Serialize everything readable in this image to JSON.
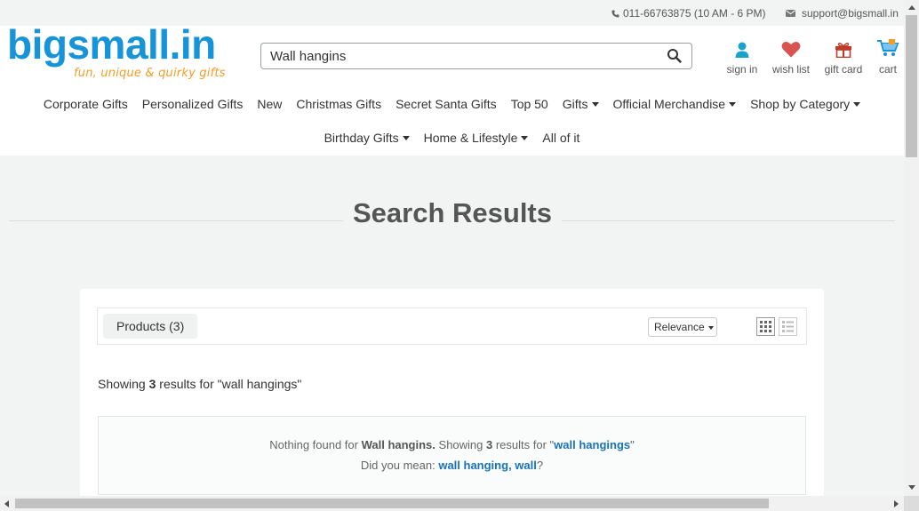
{
  "topbar": {
    "phone": "011-66763875 (10 AM - 6 PM)",
    "email": "support@bigsmall.in",
    "phone_icon": "phone-icon",
    "mail_icon": "envelope-icon"
  },
  "brand": {
    "name": "bigsmall.in",
    "tagline": "fun, unique & quirky gifts",
    "color": "#1793d8",
    "tagline_color": "#f39c26"
  },
  "search": {
    "value": "Wall hangins",
    "icon": "search-icon"
  },
  "header_icons": [
    {
      "label": "sign in",
      "icon": "user-icon",
      "color": "#1aa3c8"
    },
    {
      "label": "wish list",
      "icon": "heart-icon",
      "color": "#d9534f"
    },
    {
      "label": "gift card",
      "icon": "gift-icon",
      "color": "#c0392b"
    },
    {
      "label": "cart",
      "icon": "cart-icon",
      "color": "#1793d8"
    }
  ],
  "nav": {
    "row1": [
      {
        "label": "Corporate Gifts",
        "dropdown": false
      },
      {
        "label": "Personalized Gifts",
        "dropdown": false
      },
      {
        "label": "New",
        "dropdown": false
      },
      {
        "label": "Christmas Gifts",
        "dropdown": false
      },
      {
        "label": "Secret Santa Gifts",
        "dropdown": false
      },
      {
        "label": "Top 50",
        "dropdown": false
      },
      {
        "label": "Gifts",
        "dropdown": true
      },
      {
        "label": "Official Merchandise",
        "dropdown": true
      },
      {
        "label": "Shop by Category",
        "dropdown": true
      }
    ],
    "row2": [
      {
        "label": "Birthday Gifts",
        "dropdown": true
      },
      {
        "label": "Home & Lifestyle",
        "dropdown": true
      },
      {
        "label": "All of it",
        "dropdown": false
      }
    ]
  },
  "page_title": "Search Results",
  "results": {
    "tab_label": "Products (3)",
    "sort_value": "Relevance",
    "view_grid_icon": "grid-view-icon",
    "view_list_icon": "list-view-icon",
    "showing_prefix": "Showing ",
    "count": "3",
    "showing_suffix": " results for \"wall hangings\"",
    "notfound": {
      "prefix": "Nothing found for ",
      "query": "Wall hangins.",
      "mid": " Showing ",
      "count": "3",
      "mid2": " results for \"",
      "suggestion": "wall hangings",
      "end": "\"",
      "did_you_mean": "Did you mean: ",
      "alt1": "wall hanging",
      "sep": ", ",
      "alt2": "wall",
      "qmark": "?"
    }
  }
}
